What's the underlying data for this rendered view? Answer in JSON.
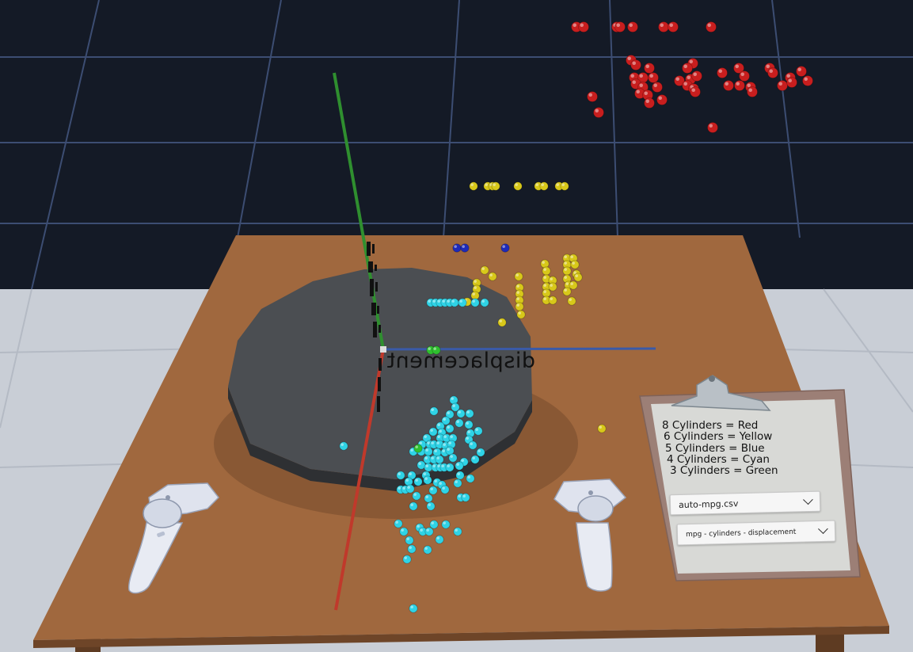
{
  "legend": {
    "lines": [
      "8 Cylinders = Red",
      "6 Cylinders = Yellow",
      "5 Cylinders = Blue",
      "4 Cylinders = Cyan",
      "3 Cylinders = Green"
    ]
  },
  "dropdowns": {
    "dataset": {
      "value": "auto-mpg.csv"
    },
    "axes": {
      "value": "mpg - cylinders - displacement"
    }
  },
  "axes": {
    "x_label": "displacement",
    "colors": {
      "x": "#3a5aa8",
      "y": "#2f8f2f",
      "z": "#c0392b"
    }
  },
  "points": {
    "colors": {
      "red": "#c81e1e",
      "yellow": "#d8c81a",
      "blue": "#1e2ab8",
      "cyan": "#2fd3e6",
      "green": "#2fc02f"
    }
  },
  "environment": {
    "wall_color": "#141a26",
    "grid_line_color": "#3c4d72",
    "floor_color": "#c9ced6",
    "table_color": "#a0683e",
    "turntable_color": "#4b4e52"
  }
}
